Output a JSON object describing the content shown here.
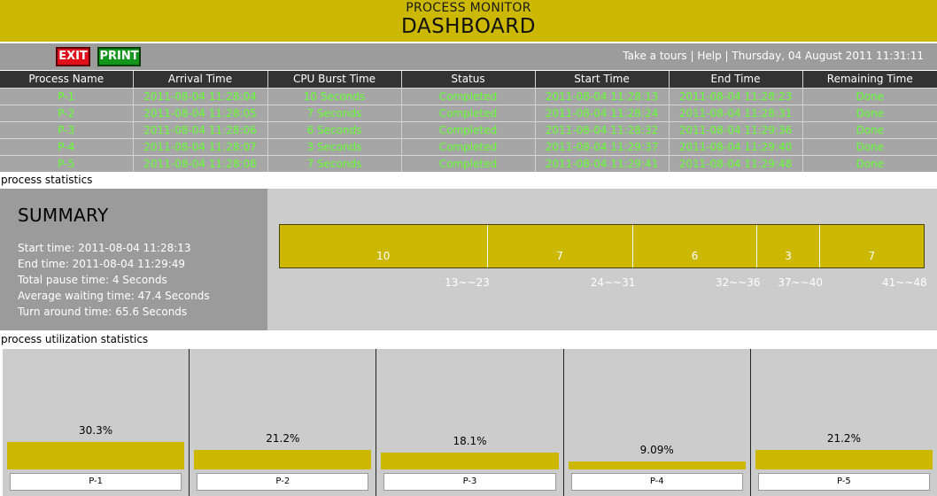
{
  "header": {
    "app_title": "PROCESS MONITOR",
    "page_title": "DASHBOARD"
  },
  "colors": {
    "accent": "#ccb800",
    "exit": "#e0101a",
    "print": "#13961b",
    "table_text": "#66ff33"
  },
  "toolbar": {
    "exit_label": "EXIT",
    "print_label": "PRINT",
    "tour_link": "Take a tours",
    "help_link": "Help",
    "sep": "|",
    "datetime": "Thursday, 04 August 2011 11:31:11"
  },
  "table": {
    "headers": [
      "Process Name",
      "Arrival Time",
      "CPU Burst Time",
      "Status",
      "Start Time",
      "End Time",
      "Remaining Time"
    ],
    "rows": [
      [
        "P-1",
        "2011-08-04 11:28:04",
        "10 Seconds",
        "Completed",
        "2011-08-04 11:28:13",
        "2011-08-04 11:28:23",
        "Done"
      ],
      [
        "P-2",
        "2011-08-04 11:28:05",
        "7 Seconds",
        "Completed",
        "2011-08-04 11:28:24",
        "2011-08-04 11:28:31",
        "Done"
      ],
      [
        "P-3",
        "2011-08-04 11:28:06",
        "6 Seconds",
        "Completed",
        "2011-08-04 11:28:32",
        "2011-08-04 11:29:36",
        "Done"
      ],
      [
        "P-4",
        "2011-08-04 11:28:07",
        "3 Seconds",
        "Completed",
        "2011-08-04 11:29:37",
        "2011-08-04 11:29:40",
        "Done"
      ],
      [
        "P-5",
        "2011-08-04 11:28:08",
        "7 Seconds",
        "Completed",
        "2011-08-04 11:29:41",
        "2011-08-04 11:29:48",
        "Done"
      ]
    ]
  },
  "stats_heading": "process statistics",
  "summary": {
    "title": "SUMMARY",
    "lines": [
      "Start time: 2011-08-04 11:28:13",
      "End time: 2011-08-04 11:29:49",
      "Total pause time: 4 Seconds",
      "Average waiting time: 47.4 Seconds",
      "Turn around time: 65.6 Seconds"
    ]
  },
  "gantt": {
    "segments": [
      {
        "value": 10,
        "label": "10",
        "range": "13~~23"
      },
      {
        "value": 7,
        "label": "7",
        "range": "24~~31"
      },
      {
        "value": 6,
        "label": "6",
        "range": "32~~36"
      },
      {
        "value": 3,
        "label": "3",
        "range": "37~~40"
      },
      {
        "value": 5,
        "label": "7",
        "range": "41~~48"
      }
    ]
  },
  "util_heading": "process utilization statistics",
  "chart_data": {
    "type": "bar",
    "categories": [
      "P-1",
      "P-2",
      "P-3",
      "P-4",
      "P-5"
    ],
    "values": [
      30.3,
      21.2,
      18.1,
      9.09,
      21.2
    ],
    "labels": [
      "30.3%",
      "21.2%",
      "18.1%",
      "9.09%",
      "21.2%"
    ],
    "ylim": [
      0,
      100
    ]
  }
}
